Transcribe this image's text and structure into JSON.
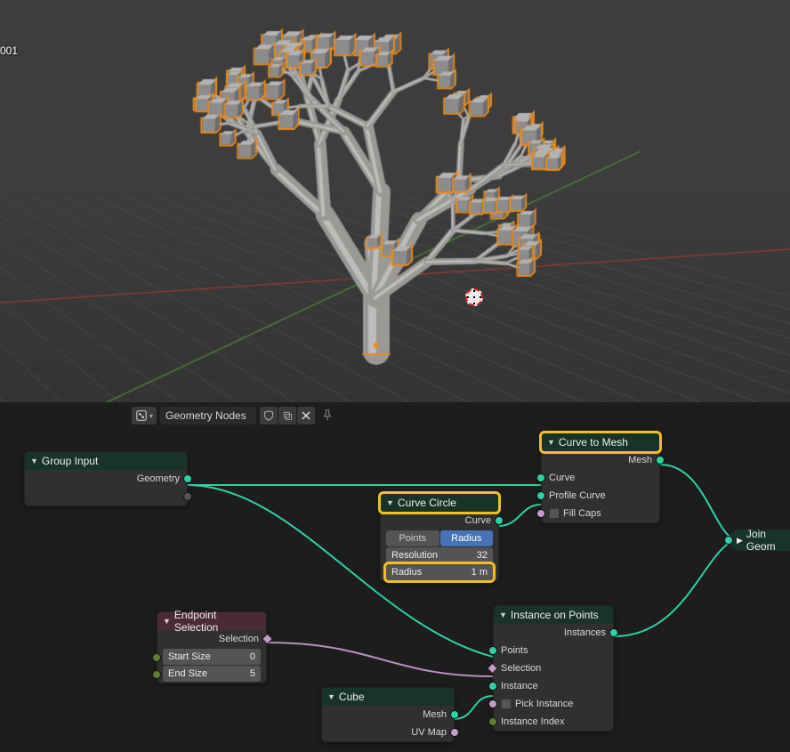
{
  "viewport": {
    "object_label": "001"
  },
  "header": {
    "editor_type_icon": "node-tree-icon",
    "tree_name": "Geometry Nodes",
    "shield_icon": "fake-user-icon",
    "copy_icon": "copy-icon",
    "delete_icon": "close-icon",
    "pin_icon": "pin-icon"
  },
  "nodes": {
    "group_input": {
      "title": "Group Input",
      "out0": "Geometry"
    },
    "endpoint_selection": {
      "title": "Endpoint Selection",
      "out0": "Selection",
      "start_label": "Start Size",
      "start_value": "0",
      "end_label": "End Size",
      "end_value": "5"
    },
    "curve_circle": {
      "title": "Curve Circle",
      "out0": "Curve",
      "mode_points": "Points",
      "mode_radius": "Radius",
      "res_label": "Resolution",
      "res_value": "32",
      "radius_label": "Radius",
      "radius_value": "1 m"
    },
    "cube": {
      "title": "Cube",
      "out0": "Mesh",
      "out1": "UV Map"
    },
    "curve_to_mesh": {
      "title": "Curve to Mesh",
      "out0": "Mesh",
      "in0": "Curve",
      "in1": "Profile Curve",
      "in2": "Fill Caps"
    },
    "instance_on_points": {
      "title": "Instance on Points",
      "out0": "Instances",
      "in0": "Points",
      "in1": "Selection",
      "in2": "Instance",
      "in3": "Pick Instance",
      "in4": "Instance Index"
    },
    "join": {
      "title": "Join Geom"
    }
  }
}
